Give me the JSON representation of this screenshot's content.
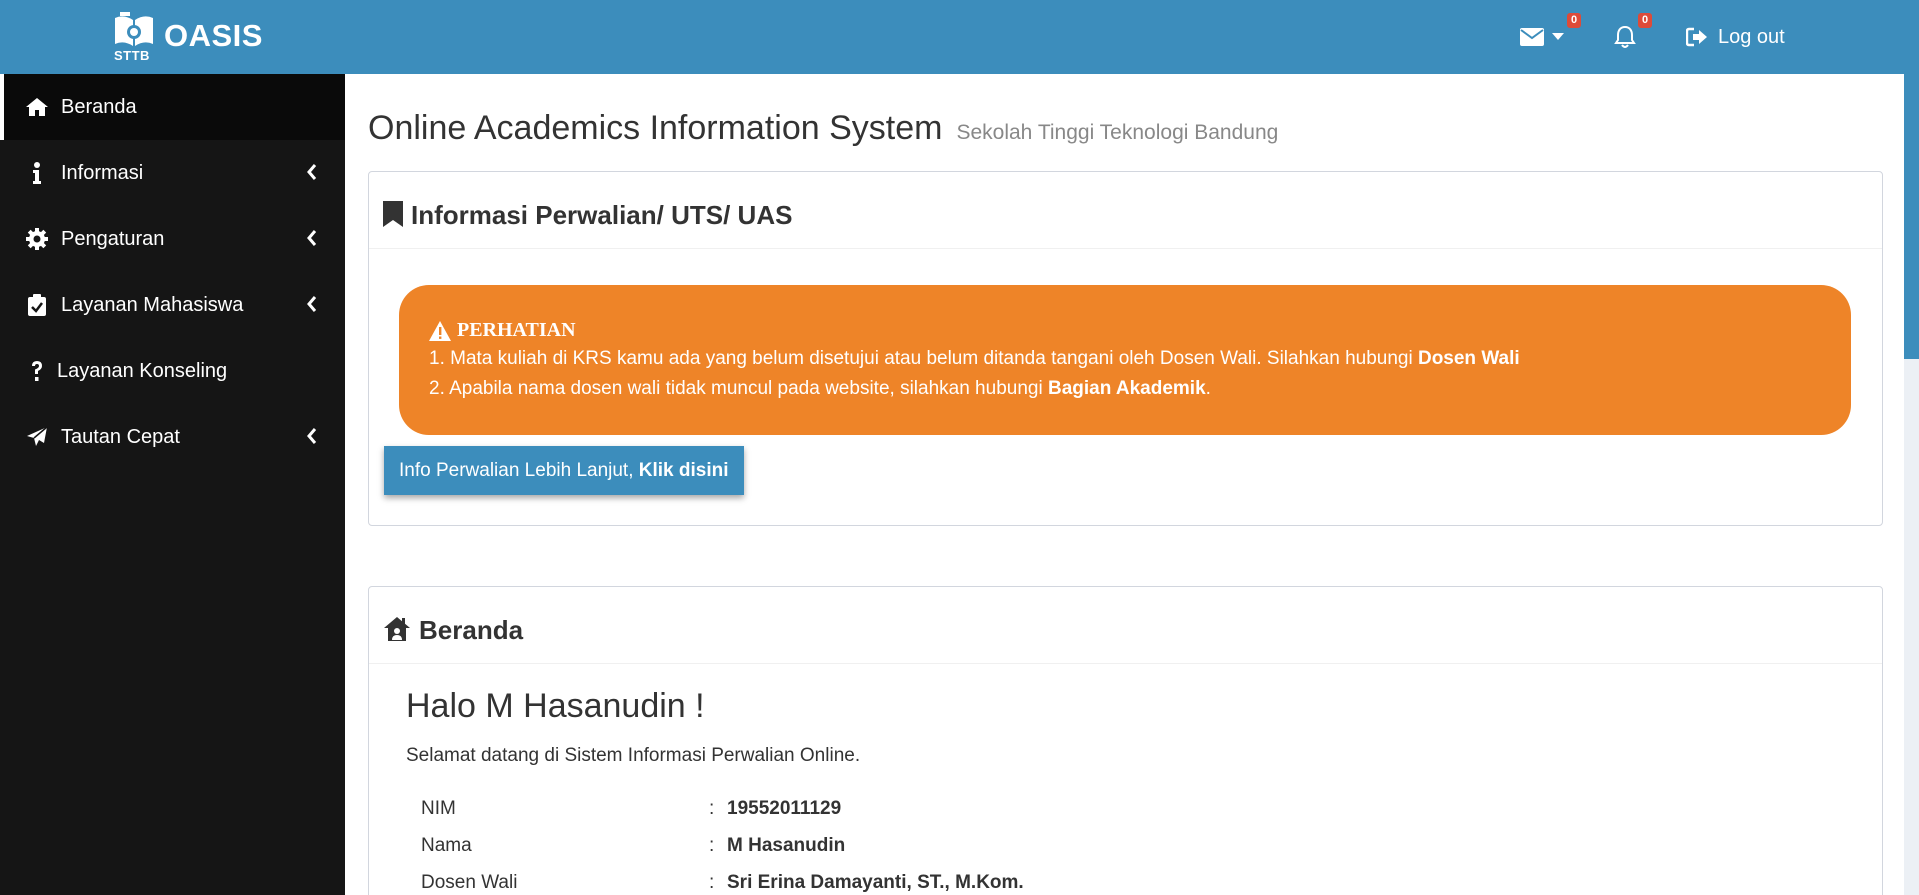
{
  "header": {
    "logo_text": "OASIS",
    "logo_sub": "STTB",
    "mail_badge": "0",
    "notif_badge": "0",
    "logout_label": "Log out"
  },
  "sidebar": {
    "items": [
      {
        "label": "Beranda",
        "icon": "home-icon"
      },
      {
        "label": "Informasi",
        "icon": "info-icon"
      },
      {
        "label": "Pengaturan",
        "icon": "gear-icon"
      },
      {
        "label": "Layanan Mahasiswa",
        "icon": "clipboard-check-icon"
      },
      {
        "label": "Layanan Konseling",
        "icon": "question-icon"
      },
      {
        "label": "Tautan Cepat",
        "icon": "paper-plane-icon"
      }
    ]
  },
  "page": {
    "title": "Online Academics Information System",
    "subtitle": "Sekolah Tinggi Teknologi Bandung"
  },
  "perwalian": {
    "title": "Informasi Perwalian/ UTS/ UAS",
    "alert_title": "PERHATIAN",
    "line1_text": "1. Mata kuliah di KRS kamu ada yang belum disetujui atau belum ditanda tangani oleh Dosen Wali. Silahkan hubungi ",
    "line1_bold": "Dosen Wali",
    "line2_text": "2. Apabila nama dosen wali tidak muncul pada website, silahkan hubungi ",
    "line2_bold": "Bagian Akademik",
    "line2_end": ".",
    "button_text": "Info Perwalian Lebih Lanjut, ",
    "button_bold": "Klik disini"
  },
  "beranda": {
    "title": "Beranda",
    "greeting": "Halo M Hasanudin !",
    "welcome": "Selamat datang di Sistem Informasi Perwalian Online.",
    "rows": [
      {
        "key": "NIM",
        "value": "19552011129"
      },
      {
        "key": "Nama",
        "value": "M Hasanudin"
      },
      {
        "key": "Dosen Wali",
        "value": "Sri Erina Damayanti, ST., M.Kom."
      }
    ]
  },
  "colors": {
    "primary": "#3c8dbc",
    "sidebar": "#151515",
    "alert": "#ee8428",
    "badge": "#dd4b39"
  }
}
